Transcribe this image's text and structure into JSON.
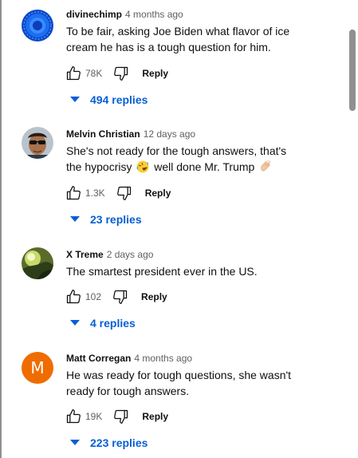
{
  "comments": [
    {
      "author": "divinechimp",
      "time": "4 months ago",
      "text": "To be fair, asking Joe Biden what flavor of ice cream he has is a tough question for him.",
      "likes": "78K",
      "reply_label": "Reply",
      "replies_label": "494 replies",
      "avatar": "blue-circle-avatar"
    },
    {
      "author": "Melvin Christian",
      "time": "12 days ago",
      "text_line1": "She's not ready for the tough answers, that's",
      "text_line2_a": "the hypocrisy",
      "text_line2_b": "well done Mr. Trump",
      "emoji_1": "rolling-on-floor-laughing-emoji",
      "emoji_2": "clapping-hands-emoji",
      "likes": "1.3K",
      "reply_label": "Reply",
      "replies_label": "23 replies",
      "avatar": "man-with-sunglasses-avatar"
    },
    {
      "author": "X Treme",
      "time": "2 days ago",
      "text": "The smartest president ever in the US.",
      "likes": "102",
      "reply_label": "Reply",
      "replies_label": "4 replies",
      "avatar": "green-landscape-avatar"
    },
    {
      "author": "Matt Corregan",
      "time": "4 months ago",
      "text_line1": "He was ready for tough questions, she wasn't",
      "text_line2": "ready for tough answers.",
      "likes": "19K",
      "reply_label": "Reply",
      "replies_label": "223 replies",
      "avatar_letter": "M",
      "avatar_color": "#ef6c00"
    }
  ],
  "colors": {
    "link_blue": "#065fd4",
    "meta_gray": "#606060",
    "text": "#0f0f0f"
  }
}
